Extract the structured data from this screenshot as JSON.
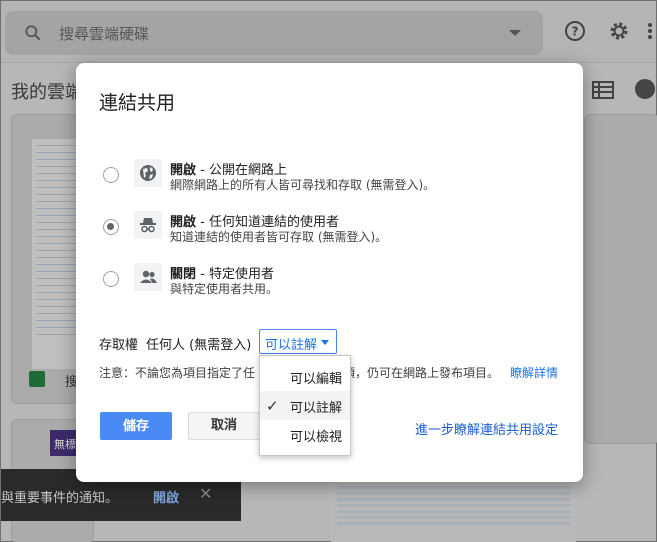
{
  "app": {
    "search_placeholder": "搜尋雲端硬碟",
    "my_drive_label": "我的雲端",
    "file_name": "搜",
    "file2_title": "無標"
  },
  "snackbar": {
    "text": "與重要事件的通知。",
    "action": "開啟",
    "close": "✕"
  },
  "dialog": {
    "title": "連結共用",
    "options": [
      {
        "title_bold": "開啟",
        "title_rest": " - 公開在網路上",
        "description": "網際網路上的所有人皆可尋找和存取 (無需登入)。",
        "icon": "globe-icon",
        "checked": false
      },
      {
        "title_bold": "開啟",
        "title_rest": " - 任何知道連結的使用者",
        "description": "知道連結的使用者皆可存取 (無需登入)。",
        "icon": "incognito-icon",
        "checked": true
      },
      {
        "title_bold": "關閉",
        "title_rest": " - 特定使用者",
        "description": "與特定使用者共用。",
        "icon": "people-icon",
        "checked": false
      }
    ],
    "access_label": "存取權",
    "access_who": "任何人 (無需登入)",
    "permission_selected": "可以註解",
    "note_start": "注意：不論您為項目指定了任",
    "note_end": "項，仍可在網路上發布項目。",
    "learn_more": "瞭解詳情",
    "save_label": "儲存",
    "cancel_label": "取消",
    "advanced_link": "進一步瞭解連結共用設定"
  },
  "menu": {
    "items": [
      {
        "label": "可以編輯",
        "selected": false
      },
      {
        "label": "可以註解",
        "selected": true
      },
      {
        "label": "可以檢視",
        "selected": false
      }
    ],
    "check_glyph": "✓"
  },
  "colors": {
    "accent": "#1a73e8",
    "save_button": "#4a8af4",
    "overlay": "#b7b7b7"
  }
}
